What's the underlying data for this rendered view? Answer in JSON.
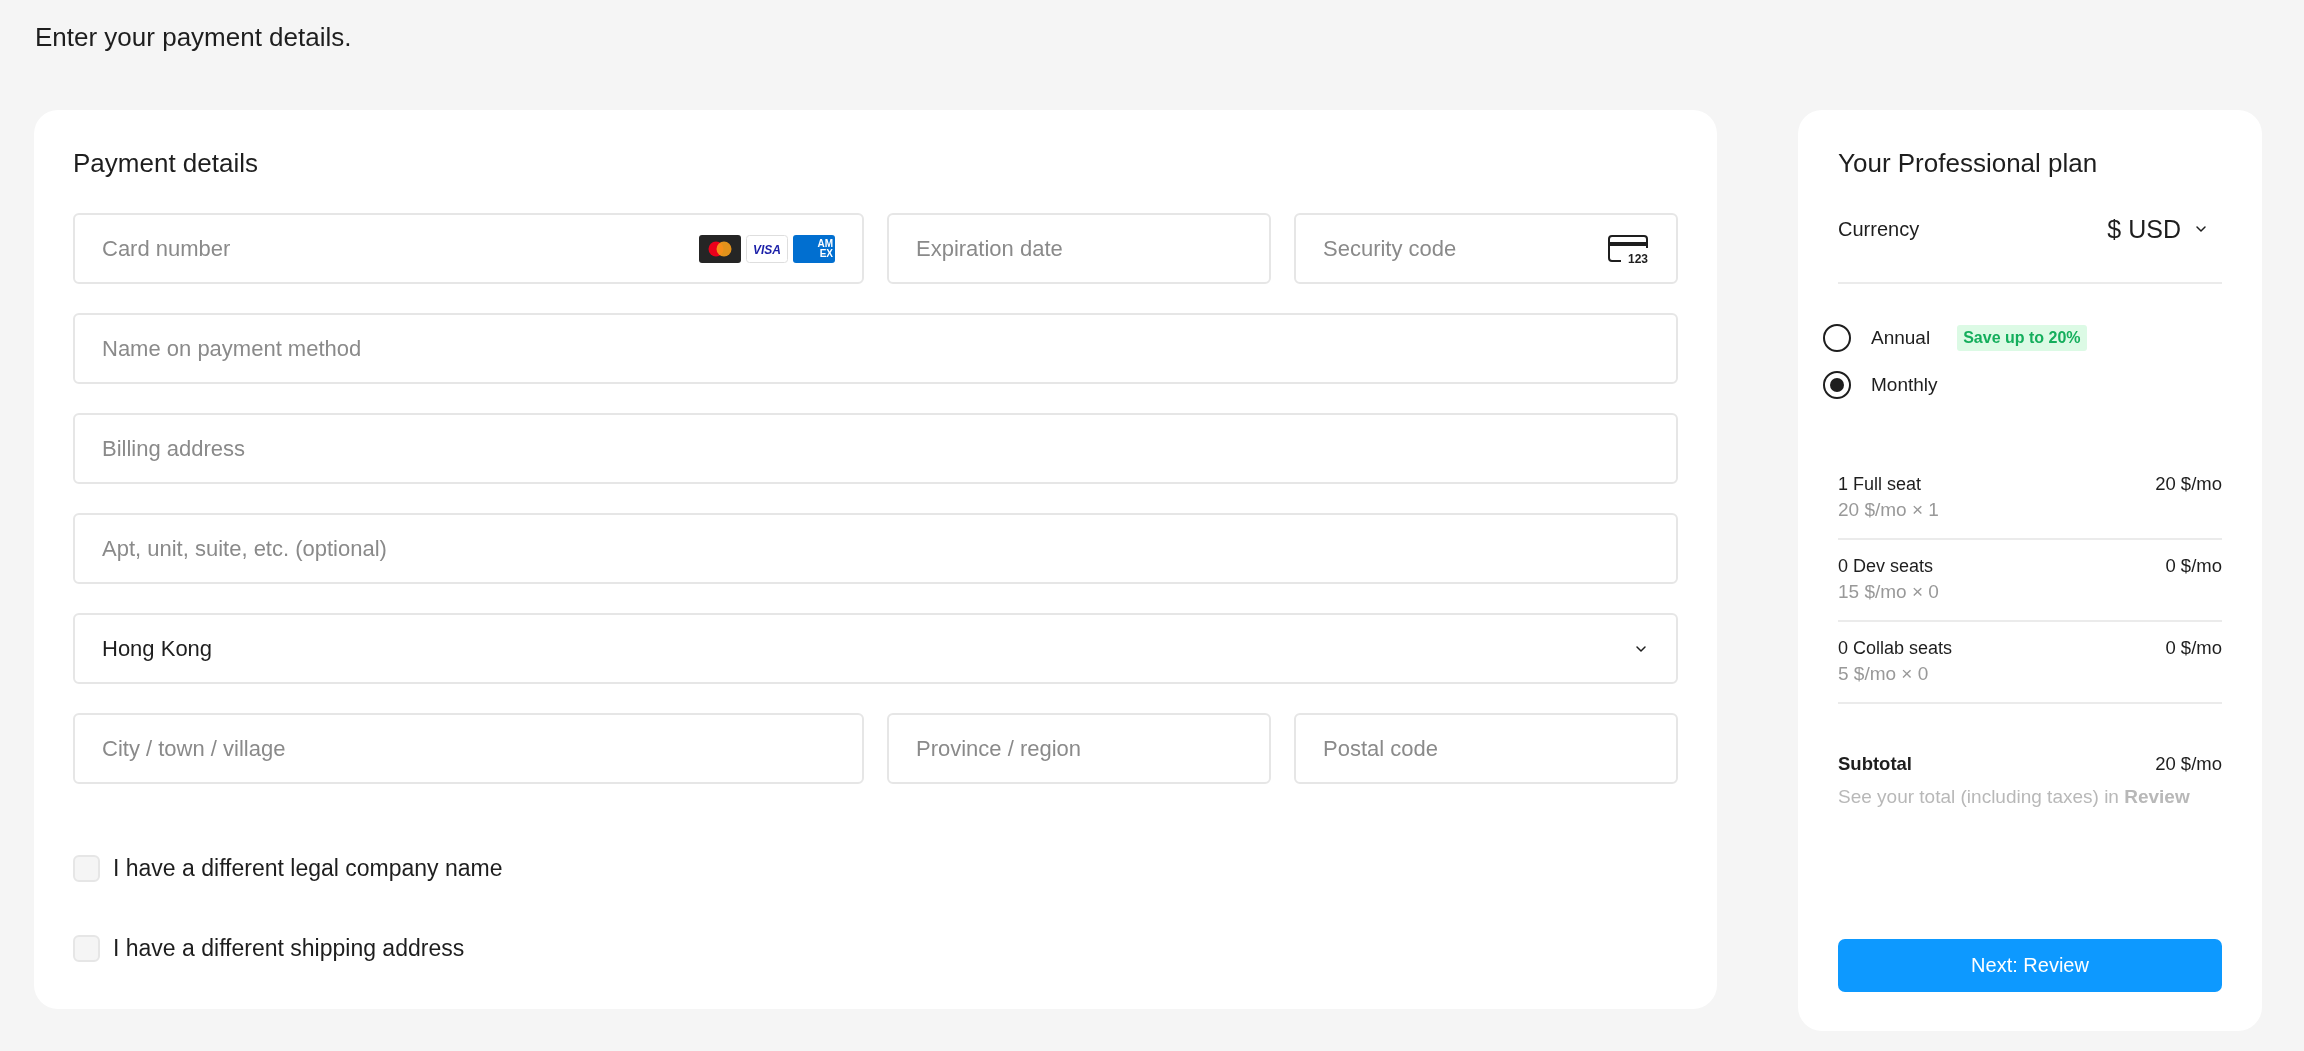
{
  "heading": "Enter your payment details.",
  "payment_form": {
    "title": "Payment details",
    "rows": [
      [
        {
          "kind": "card_number",
          "placeholder": "Card number",
          "card_brands": [
            {
              "kind": "mastercard"
            },
            {
              "kind": "visa",
              "text": "VISA"
            },
            {
              "kind": "amex",
              "lines": [
                "AM",
                "EX"
              ]
            }
          ]
        },
        {
          "kind": "text",
          "placeholder": "Expiration date"
        },
        {
          "kind": "security_code",
          "placeholder": "Security code",
          "icon_text": "123"
        }
      ],
      [
        {
          "kind": "text",
          "placeholder": "Name on payment method"
        }
      ],
      [
        {
          "kind": "text",
          "placeholder": "Billing address"
        }
      ],
      [
        {
          "kind": "text",
          "placeholder": "Apt, unit, suite, etc. (optional)"
        }
      ],
      [
        {
          "kind": "select",
          "value": "Hong Kong"
        }
      ],
      [
        {
          "kind": "text",
          "placeholder": "City / town / village"
        },
        {
          "kind": "text",
          "placeholder": "Province / region"
        },
        {
          "kind": "text",
          "placeholder": "Postal code"
        }
      ]
    ],
    "checkboxes": [
      {
        "label": "I have a different legal company name",
        "checked": false
      },
      {
        "label": "I have a different shipping address",
        "checked": false
      }
    ]
  },
  "order_summary": {
    "title": "Your Professional plan",
    "currency": {
      "label": "Currency",
      "value": "$ USD"
    },
    "billing_periods": [
      {
        "label": "Annual",
        "badge": "Save up to 20%",
        "selected": false
      },
      {
        "label": "Monthly",
        "selected": true
      }
    ],
    "seats": [
      {
        "name": "1 Full seat",
        "detail": "20 $/mo × 1",
        "price": "20 $/mo"
      },
      {
        "name": "0 Dev seats",
        "detail": "15 $/mo × 0",
        "price": "0 $/mo"
      },
      {
        "name": "0 Collab seats",
        "detail": "5 $/mo × 0",
        "price": "0 $/mo"
      }
    ],
    "subtotal": {
      "label": "Subtotal",
      "price": "20 $/mo",
      "note": "See your total (including taxes) in **Review**"
    },
    "button": {
      "label": "Next: Review"
    }
  }
}
